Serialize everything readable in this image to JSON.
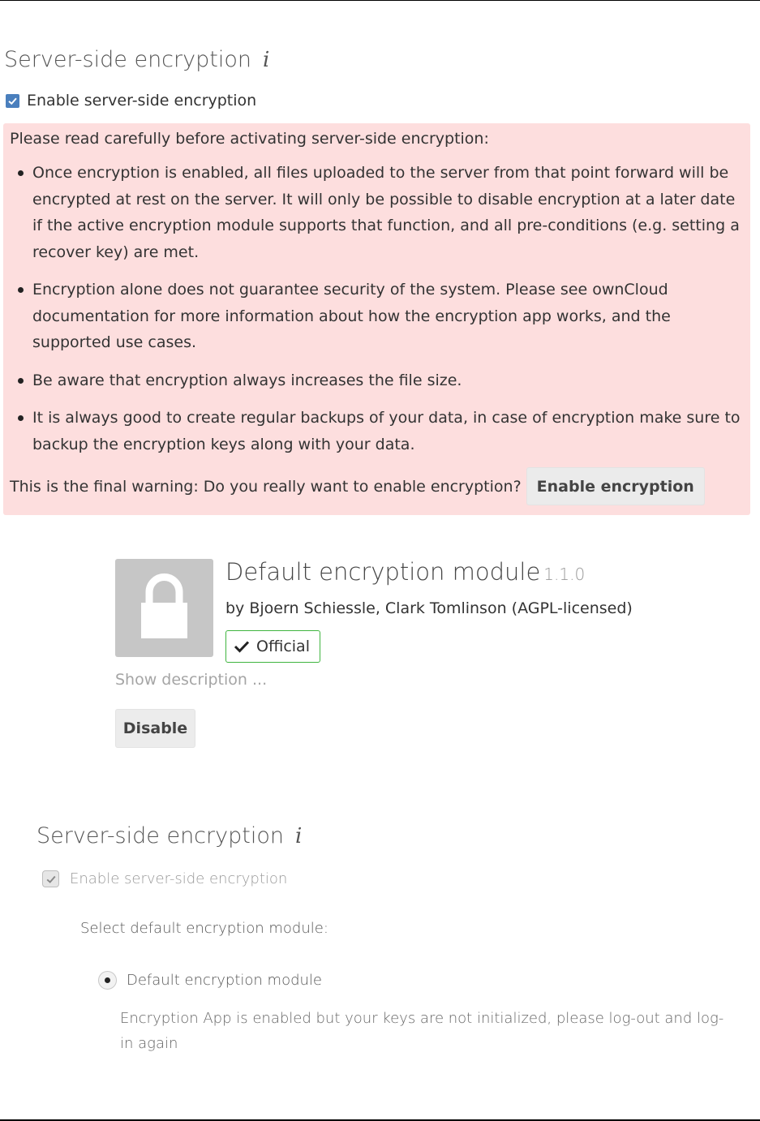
{
  "section_encryption": {
    "heading": "Server-side encryption",
    "info_icon": "i",
    "enable_label": "Enable server-side encryption",
    "enable_checked": true
  },
  "warning": {
    "intro": "Please read carefully before activating server-side encryption:",
    "items": [
      "Once encryption is enabled, all files uploaded to the server from that point forward will be encrypted at rest on the server. It will only be possible to disable encryption at a later date if the active encryption module supports that function, and all pre-conditions (e.g. setting a recover key) are met.",
      "Encryption alone does not guarantee security of the system. Please see ownCloud documentation for more information about how the encryption app works, and the supported use cases.",
      "Be aware that encryption always increases the file size.",
      "It is always good to create regular backups of your data, in case of encryption make sure to backup the encryption keys along with your data."
    ],
    "final_text": "This is the final warning: Do you really want to enable encryption?",
    "enable_button": "Enable encryption",
    "background_color": "#fddede"
  },
  "app": {
    "icon": "lock-icon",
    "name": "Default encryption module",
    "version": "1.1.0",
    "author": "by Bjoern Schiessle, Clark Tomlinson (AGPL-licensed)",
    "badge": "Official",
    "badge_color": "#3fb53f",
    "show_description": "Show description ...",
    "disable_button": "Disable"
  },
  "section_admin": {
    "heading": "Server-side encryption",
    "info_icon": "i",
    "enable_label": "Enable server-side encryption",
    "enable_checked": true,
    "enable_disabled": true,
    "select_label": "Select default encryption module:",
    "modules": [
      {
        "label": "Default encryption module",
        "selected": true,
        "message": "Encryption App is enabled but your keys are not initialized, please log-out and log-in again"
      }
    ]
  }
}
